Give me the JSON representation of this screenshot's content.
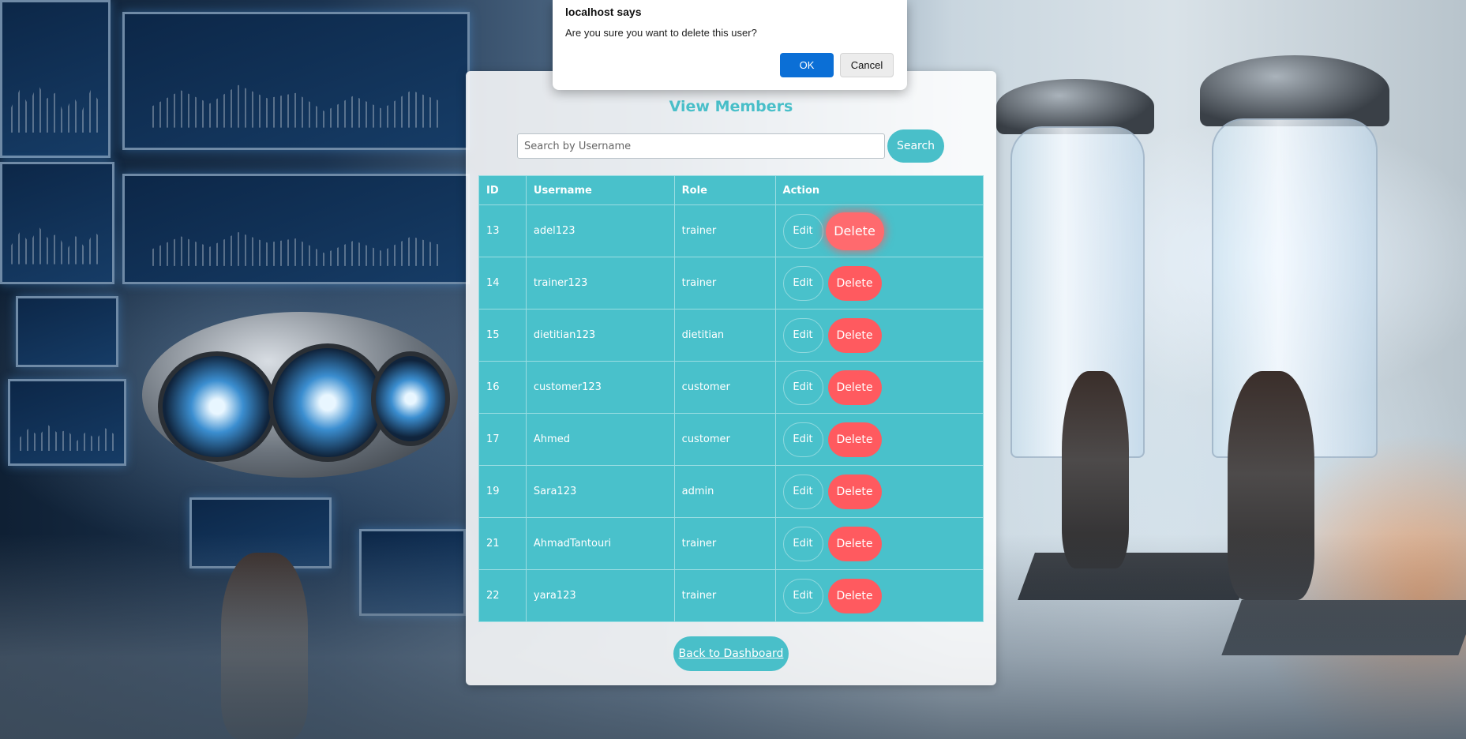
{
  "dialog": {
    "title": "localhost says",
    "message": "Are you sure you want to delete this user?",
    "ok_label": "OK",
    "cancel_label": "Cancel"
  },
  "page": {
    "title": "View Members",
    "back_label": "Back to Dashboard"
  },
  "search": {
    "placeholder": "Search by Username",
    "value": "",
    "button_label": "Search"
  },
  "table": {
    "headers": [
      "ID",
      "Username",
      "Role",
      "Action"
    ],
    "edit_label": "Edit",
    "delete_label": "Delete",
    "rows": [
      {
        "id": "13",
        "username": "adel123",
        "role": "trainer"
      },
      {
        "id": "14",
        "username": "trainer123",
        "role": "trainer"
      },
      {
        "id": "15",
        "username": "dietitian123",
        "role": "dietitian"
      },
      {
        "id": "16",
        "username": "customer123",
        "role": "customer"
      },
      {
        "id": "17",
        "username": "Ahmed",
        "role": "customer"
      },
      {
        "id": "19",
        "username": "Sara123",
        "role": "admin"
      },
      {
        "id": "21",
        "username": "AhmadTantouri",
        "role": "trainer"
      },
      {
        "id": "22",
        "username": "yara123",
        "role": "trainer"
      }
    ]
  },
  "colors": {
    "accent": "#49bfc9",
    "delete": "#ff5a5f",
    "dialog_ok": "#0b6fd6"
  }
}
